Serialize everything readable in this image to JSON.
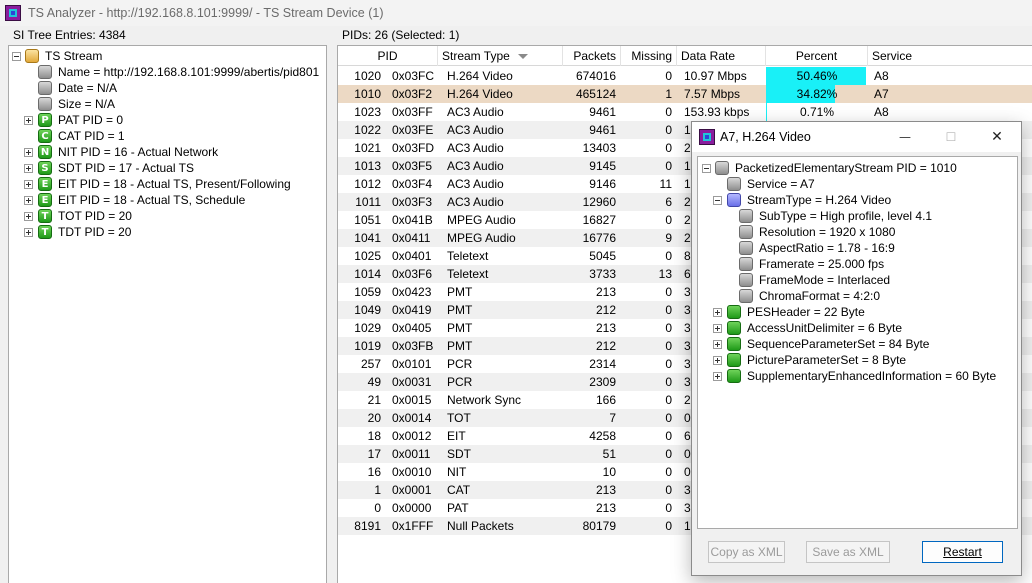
{
  "window": {
    "title": "TS Analyzer - http://192.168.8.101:9999/ - TS Stream Device (1)"
  },
  "left_pane": {
    "header": "SI Tree Entries: 4384",
    "tree": [
      {
        "label": "TS Stream",
        "level": 0,
        "icon": "folder",
        "glyph": "",
        "expander": "minus"
      },
      {
        "label": "Name = http://192.168.8.101:9999/abertis/pid801",
        "level": 1,
        "icon": "grey",
        "glyph": "",
        "expander": ""
      },
      {
        "label": "Date = N/A",
        "level": 1,
        "icon": "grey",
        "glyph": "",
        "expander": ""
      },
      {
        "label": "Size = N/A",
        "level": 1,
        "icon": "grey",
        "glyph": "",
        "expander": ""
      },
      {
        "label": "PAT PID = 0",
        "level": 1,
        "icon": "green",
        "glyph": "P",
        "expander": "plus"
      },
      {
        "label": "CAT PID = 1",
        "level": 1,
        "icon": "green",
        "glyph": "C",
        "expander": ""
      },
      {
        "label": "NIT PID = 16 - Actual Network",
        "level": 1,
        "icon": "green",
        "glyph": "N",
        "expander": "plus"
      },
      {
        "label": "SDT PID = 17 - Actual TS",
        "level": 1,
        "icon": "green",
        "glyph": "S",
        "expander": "plus"
      },
      {
        "label": "EIT PID = 18 - Actual TS, Present/Following",
        "level": 1,
        "icon": "green",
        "glyph": "E",
        "expander": "plus"
      },
      {
        "label": "EIT PID = 18 - Actual TS, Schedule",
        "level": 1,
        "icon": "green",
        "glyph": "E",
        "expander": "plus"
      },
      {
        "label": "TOT PID = 20",
        "level": 1,
        "icon": "green",
        "glyph": "T",
        "expander": "plus"
      },
      {
        "label": "TDT PID = 20",
        "level": 1,
        "icon": "green",
        "glyph": "T",
        "expander": "plus"
      }
    ]
  },
  "grid": {
    "header": "PIDs: 26   (Selected: 1)",
    "columns": [
      "PID",
      "Stream Type",
      "Packets",
      "Missing",
      "Data Rate",
      "Percent",
      "Service"
    ],
    "rows": [
      {
        "pid": "1020",
        "hex": "0x03FC",
        "type": "H.264 Video",
        "packets": "674016",
        "missing": "0",
        "rate": "10.97 Mbps",
        "percent": "50.46%",
        "pct": 50.46,
        "service": "A8"
      },
      {
        "pid": "1010",
        "hex": "0x03F2",
        "type": "H.264 Video",
        "packets": "465124",
        "missing": "1",
        "rate": "7.57 Mbps",
        "percent": "34.82%",
        "pct": 34.82,
        "service": "A7"
      },
      {
        "pid": "1023",
        "hex": "0x03FF",
        "type": "AC3 Audio",
        "packets": "9461",
        "missing": "0",
        "rate": "153.93 kbps",
        "percent": "0.71%",
        "pct": 0.71,
        "service": "A8"
      },
      {
        "pid": "1022",
        "hex": "0x03FE",
        "type": "AC3 Audio",
        "packets": "9461",
        "missing": "0",
        "rate": "1",
        "percent": "",
        "pct": 0,
        "service": ""
      },
      {
        "pid": "1021",
        "hex": "0x03FD",
        "type": "AC3 Audio",
        "packets": "13403",
        "missing": "0",
        "rate": "2",
        "percent": "",
        "pct": 0,
        "service": ""
      },
      {
        "pid": "1013",
        "hex": "0x03F5",
        "type": "AC3 Audio",
        "packets": "9145",
        "missing": "0",
        "rate": "1",
        "percent": "",
        "pct": 0,
        "service": ""
      },
      {
        "pid": "1012",
        "hex": "0x03F4",
        "type": "AC3 Audio",
        "packets": "9146",
        "missing": "11",
        "rate": "1",
        "percent": "",
        "pct": 0,
        "service": ""
      },
      {
        "pid": "1011",
        "hex": "0x03F3",
        "type": "AC3 Audio",
        "packets": "12960",
        "missing": "6",
        "rate": "2",
        "percent": "",
        "pct": 0,
        "service": ""
      },
      {
        "pid": "1051",
        "hex": "0x041B",
        "type": "MPEG Audio",
        "packets": "16827",
        "missing": "0",
        "rate": "2",
        "percent": "",
        "pct": 0,
        "service": ""
      },
      {
        "pid": "1041",
        "hex": "0x0411",
        "type": "MPEG Audio",
        "packets": "16776",
        "missing": "9",
        "rate": "2",
        "percent": "",
        "pct": 0,
        "service": ""
      },
      {
        "pid": "1025",
        "hex": "0x0401",
        "type": "Teletext",
        "packets": "5045",
        "missing": "0",
        "rate": "8",
        "percent": "",
        "pct": 0,
        "service": ""
      },
      {
        "pid": "1014",
        "hex": "0x03F6",
        "type": "Teletext",
        "packets": "3733",
        "missing": "13",
        "rate": "6",
        "percent": "",
        "pct": 0,
        "service": ""
      },
      {
        "pid": "1059",
        "hex": "0x0423",
        "type": "PMT",
        "packets": "213",
        "missing": "0",
        "rate": "3",
        "percent": "",
        "pct": 0,
        "service": ""
      },
      {
        "pid": "1049",
        "hex": "0x0419",
        "type": "PMT",
        "packets": "212",
        "missing": "0",
        "rate": "3",
        "percent": "",
        "pct": 0,
        "service": ""
      },
      {
        "pid": "1029",
        "hex": "0x0405",
        "type": "PMT",
        "packets": "213",
        "missing": "0",
        "rate": "3",
        "percent": "",
        "pct": 0,
        "service": ""
      },
      {
        "pid": "1019",
        "hex": "0x03FB",
        "type": "PMT",
        "packets": "212",
        "missing": "0",
        "rate": "3",
        "percent": "",
        "pct": 0,
        "service": ""
      },
      {
        "pid": "257",
        "hex": "0x0101",
        "type": "PCR",
        "packets": "2314",
        "missing": "0",
        "rate": "3",
        "percent": "",
        "pct": 0,
        "service": ""
      },
      {
        "pid": "49",
        "hex": "0x0031",
        "type": "PCR",
        "packets": "2309",
        "missing": "0",
        "rate": "3",
        "percent": "",
        "pct": 0,
        "service": ""
      },
      {
        "pid": "21",
        "hex": "0x0015",
        "type": "Network Sync",
        "packets": "166",
        "missing": "0",
        "rate": "2",
        "percent": "",
        "pct": 0,
        "service": ""
      },
      {
        "pid": "20",
        "hex": "0x0014",
        "type": "TOT",
        "packets": "7",
        "missing": "0",
        "rate": "0",
        "percent": "",
        "pct": 0,
        "service": ""
      },
      {
        "pid": "18",
        "hex": "0x0012",
        "type": "EIT",
        "packets": "4258",
        "missing": "0",
        "rate": "6",
        "percent": "",
        "pct": 0,
        "service": ""
      },
      {
        "pid": "17",
        "hex": "0x0011",
        "type": "SDT",
        "packets": "51",
        "missing": "0",
        "rate": "0",
        "percent": "",
        "pct": 0,
        "service": ""
      },
      {
        "pid": "16",
        "hex": "0x0010",
        "type": "NIT",
        "packets": "10",
        "missing": "0",
        "rate": "0",
        "percent": "",
        "pct": 0,
        "service": ""
      },
      {
        "pid": "1",
        "hex": "0x0001",
        "type": "CAT",
        "packets": "213",
        "missing": "0",
        "rate": "3",
        "percent": "",
        "pct": 0,
        "service": ""
      },
      {
        "pid": "0",
        "hex": "0x0000",
        "type": "PAT",
        "packets": "213",
        "missing": "0",
        "rate": "3",
        "percent": "",
        "pct": 0,
        "service": ""
      },
      {
        "pid": "8191",
        "hex": "0x1FFF",
        "type": "Null Packets",
        "packets": "80179",
        "missing": "0",
        "rate": "1",
        "percent": "",
        "pct": 0,
        "service": ""
      }
    ],
    "selected_index": 1,
    "colors": {
      "percent_bar": "#19f0f7",
      "selected_row": "#ecd9c4",
      "alt_row": "#f0f0f0"
    }
  },
  "dialog": {
    "title": "A7, H.264 Video",
    "minimize_glyph": "—",
    "maximize_glyph": "☐",
    "close_glyph": "✕",
    "tree": [
      {
        "label": "PacketizedElementaryStream PID = 1010",
        "level": 0,
        "icon": "grey",
        "expander": "minus"
      },
      {
        "label": "Service = A7",
        "level": 1,
        "icon": "grey",
        "expander": ""
      },
      {
        "label": "StreamType = H.264 Video",
        "level": 1,
        "icon": "blue",
        "expander": "minus"
      },
      {
        "label": "SubType = High profile, level 4.1",
        "level": 2,
        "icon": "grey",
        "expander": ""
      },
      {
        "label": "Resolution = 1920 x 1080",
        "level": 2,
        "icon": "grey",
        "expander": ""
      },
      {
        "label": "AspectRatio = 1.78 - 16:9",
        "level": 2,
        "icon": "grey",
        "expander": ""
      },
      {
        "label": "Framerate = 25.000 fps",
        "level": 2,
        "icon": "grey",
        "expander": ""
      },
      {
        "label": "FrameMode = Interlaced",
        "level": 2,
        "icon": "grey",
        "expander": ""
      },
      {
        "label": "ChromaFormat = 4:2:0",
        "level": 2,
        "icon": "grey",
        "expander": ""
      },
      {
        "label": "PESHeader = 22 Byte",
        "level": 1,
        "icon": "greenplain",
        "expander": "plus"
      },
      {
        "label": "AccessUnitDelimiter = 6 Byte",
        "level": 1,
        "icon": "greenplain",
        "expander": "plus"
      },
      {
        "label": "SequenceParameterSet = 84 Byte",
        "level": 1,
        "icon": "greenplain",
        "expander": "plus"
      },
      {
        "label": "PictureParameterSet = 8 Byte",
        "level": 1,
        "icon": "greenplain",
        "expander": "plus"
      },
      {
        "label": "SupplementaryEnhancedInformation = 60 Byte",
        "level": 1,
        "icon": "greenplain",
        "expander": "plus"
      }
    ],
    "buttons": {
      "copy_xml": "Copy as XML",
      "save_xml": "Save as XML",
      "restart": "Restart"
    }
  }
}
